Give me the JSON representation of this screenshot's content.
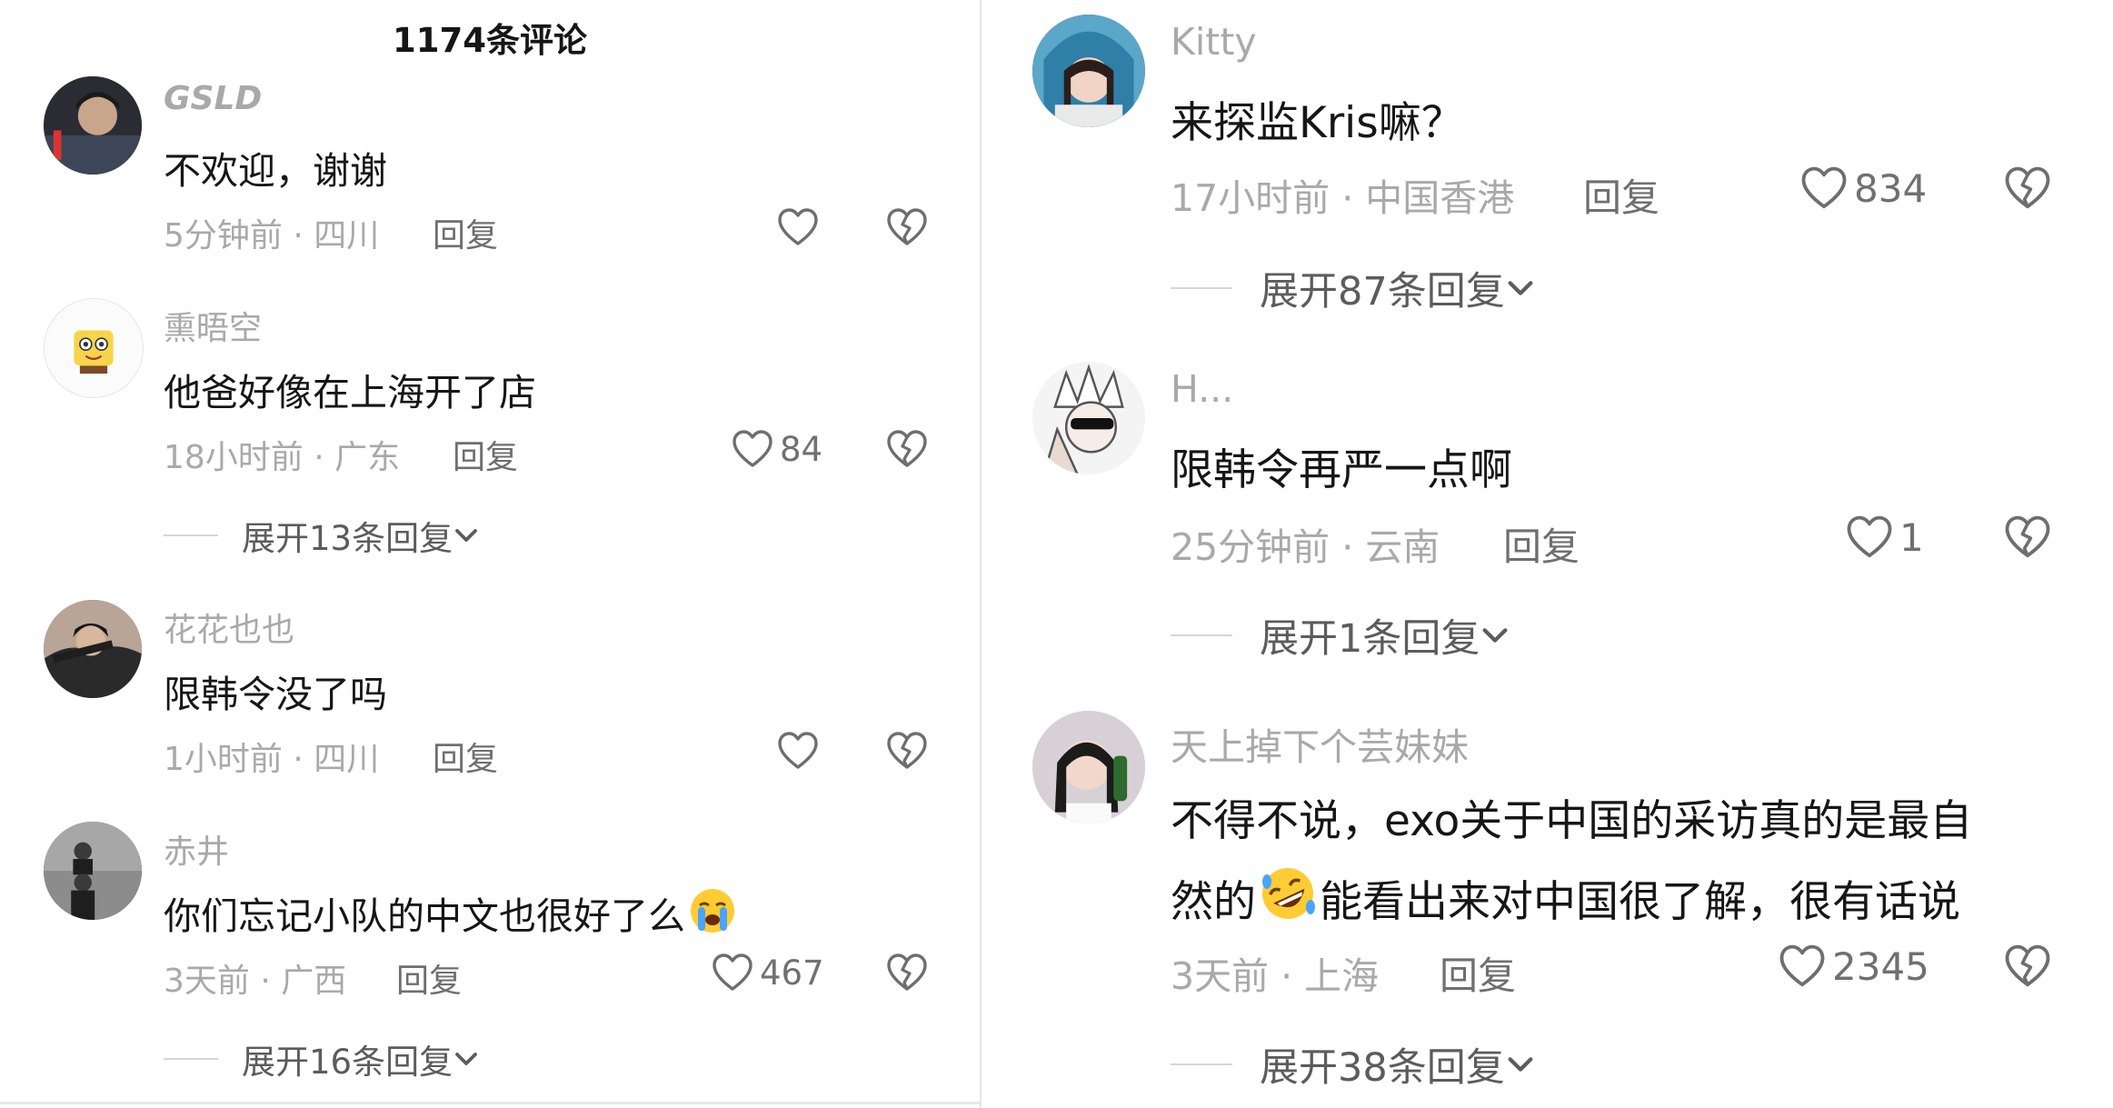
{
  "header": {
    "comment_count_title": "1174条评论"
  },
  "left_comments": [
    {
      "username": "GSLD",
      "text": "不欢迎，谢谢",
      "time_location": "5分钟前 · 四川",
      "reply_label": "回复",
      "likes": ""
    },
    {
      "username": "熏晤空",
      "text": "他爸好像在上海开了店",
      "time_location": "18小时前 · 广东",
      "reply_label": "回复",
      "likes": "84",
      "expand_label": "展开13条回复"
    },
    {
      "username": "花花也也",
      "text": "限韩令没了吗",
      "time_location": "1小时前 · 四川",
      "reply_label": "回复",
      "likes": ""
    },
    {
      "username": "赤井",
      "text": "你们忘记小队的中文也很好了么",
      "time_location": "3天前 · 广西",
      "reply_label": "回复",
      "likes": "467",
      "expand_label": "展开16条回复"
    }
  ],
  "right_comments": [
    {
      "username": "Kitty",
      "text": "来探监Kris嘛？",
      "time_location": "17小时前 · 中国香港",
      "reply_label": "回复",
      "likes": "834",
      "expand_label": "展开87条回复"
    },
    {
      "username": "H...",
      "text": "限韩令再严一点啊",
      "time_location": "25分钟前 · 云南",
      "reply_label": "回复",
      "likes": "1",
      "expand_label": "展开1条回复"
    },
    {
      "username": "天上掉下个芸妹妹",
      "text_line1": "不得不说，exo关于中国的采访真的是最自",
      "text_line2_a": "然的",
      "text_line2_b": "能看出来对中国很了解，很有话说",
      "time_location": "3天前 · 上海",
      "reply_label": "回复",
      "likes": "2345",
      "expand_label": "展开38条回复"
    }
  ],
  "icons": {
    "like": "heart-outline-icon",
    "dislike": "broken-heart-icon",
    "expand": "chevron-down-icon",
    "crying_emoji": "loudly-crying-face-emoji",
    "laughing_emoji": "rolling-on-floor-laughing-emoji"
  },
  "colors": {
    "secondary_text": "#a9a9a9",
    "primary_text": "#161616",
    "icon_gray": "#707070"
  }
}
